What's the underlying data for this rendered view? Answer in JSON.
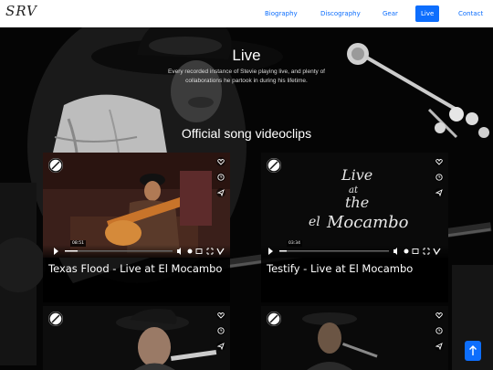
{
  "nav": {
    "brand": "SRV",
    "links": [
      {
        "label": "Biography",
        "active": false
      },
      {
        "label": "Discography",
        "active": false
      },
      {
        "label": "Gear",
        "active": false
      },
      {
        "label": "Live",
        "active": true
      },
      {
        "label": "Contact",
        "active": false
      }
    ]
  },
  "hero": {
    "title": "Live",
    "subtitle": "Every recorded instance of Stevie playing live, and plenty of collaborations he partook in during his lifetime."
  },
  "section": {
    "title": "Official song videoclips"
  },
  "cards": [
    {
      "title": "Texas Flood - Live at El Mocambo",
      "time": "08:51",
      "poster_text": ""
    },
    {
      "title": "Testify - Live at El Mocambo",
      "time": "03:34",
      "poster_text": "Live at the El Mocambo"
    },
    {
      "title": "",
      "time": ""
    },
    {
      "title": "",
      "time": ""
    }
  ],
  "icons": {
    "card_side": [
      "heart-icon",
      "clock-icon",
      "share-icon"
    ],
    "player_controls": [
      "play-icon",
      "volume-icon",
      "settings-icon",
      "pip-icon",
      "fullscreen-icon",
      "vimeo-icon"
    ],
    "back_to_top": "arrow-up-icon"
  },
  "colors": {
    "accent": "#0d6efd",
    "page_bg": "#000000",
    "nav_bg": "#ffffff"
  }
}
